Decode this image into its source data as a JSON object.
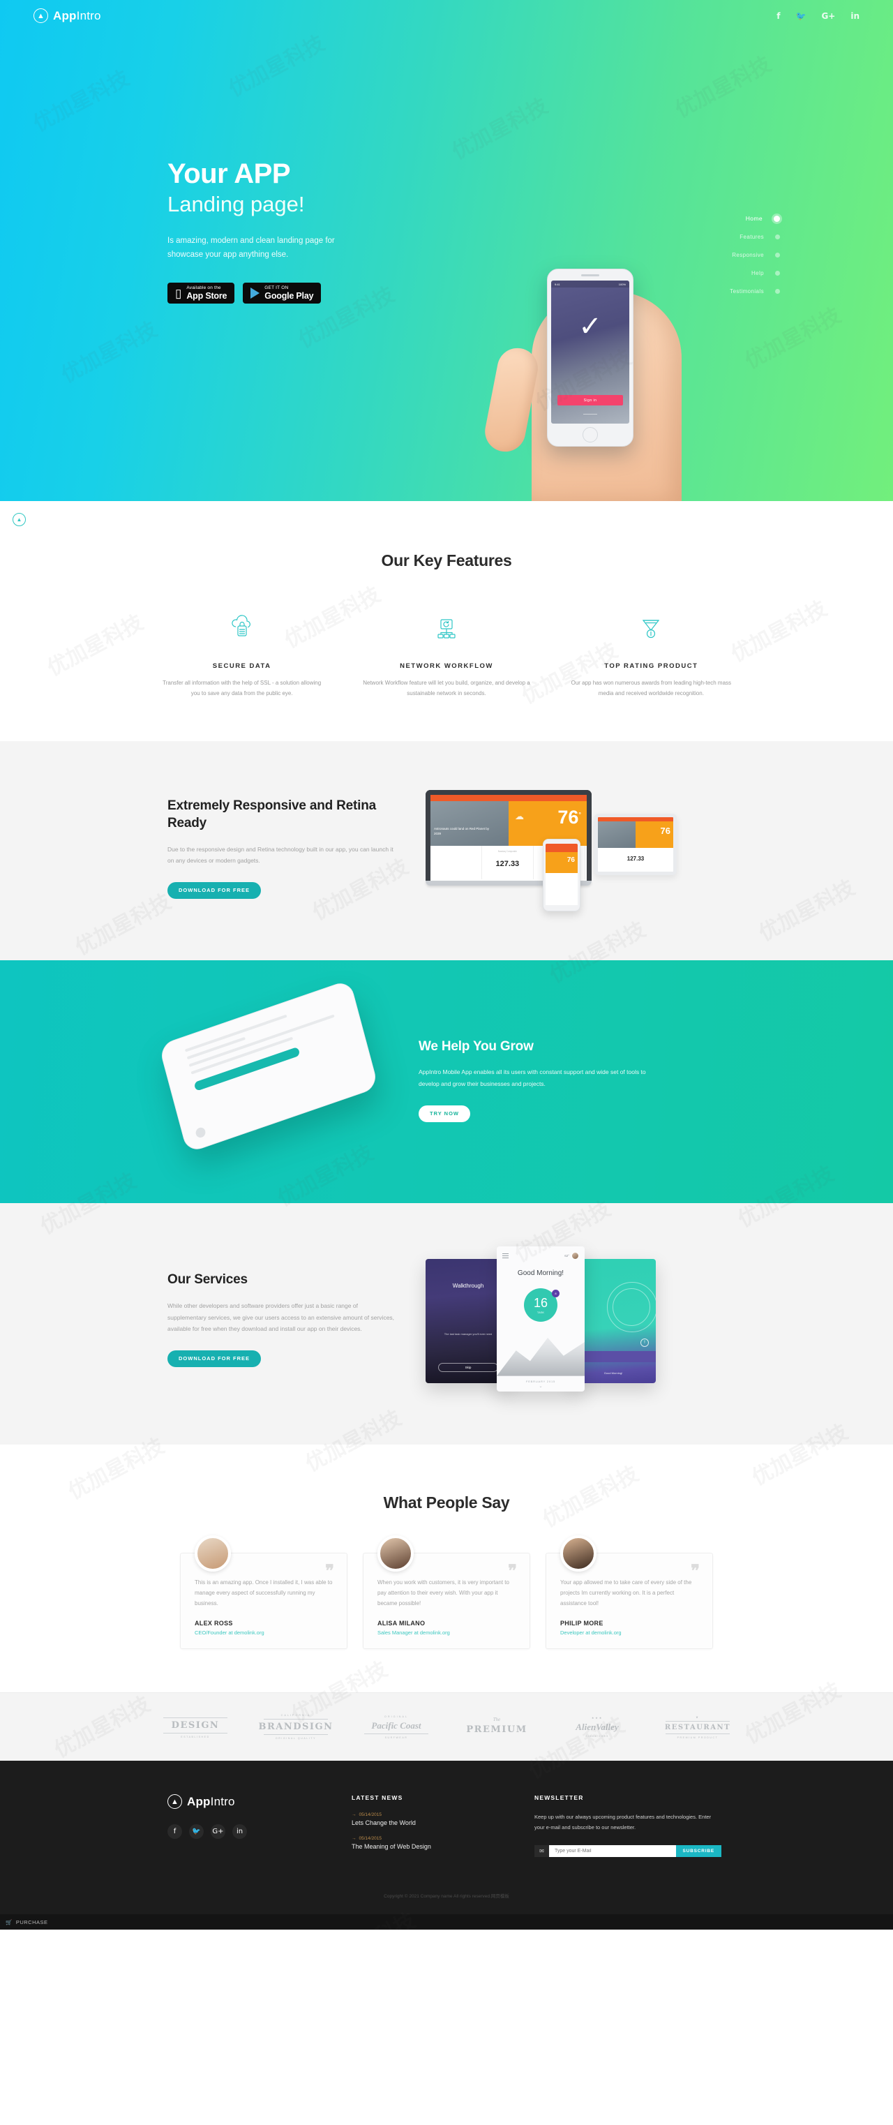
{
  "brand": {
    "mark": "A",
    "bold": "App",
    "light": "Intro"
  },
  "topbar": {
    "socials": [
      {
        "name": "facebook-icon",
        "glyph": "f"
      },
      {
        "name": "twitter-icon",
        "glyph": "🐦"
      },
      {
        "name": "google-plus-icon",
        "glyph": "G+"
      },
      {
        "name": "linkedin-icon",
        "glyph": "in"
      }
    ]
  },
  "hero": {
    "title": "Your APP",
    "subtitle": "Landing page!",
    "description": "Is amazing, modern and clean landing page for showcase your app anything else.",
    "buttons": [
      {
        "small": "Available on the",
        "big": "App Store",
        "icon": "apple-phone-icon"
      },
      {
        "small": "GET IT ON",
        "big": "Google Play",
        "icon": "google-play-icon"
      }
    ],
    "dotnav": [
      {
        "label": "Home",
        "active": true
      },
      {
        "label": "Features",
        "active": false
      },
      {
        "label": "Responsive",
        "active": false
      },
      {
        "label": "Help",
        "active": false
      },
      {
        "label": "Testimonials",
        "active": false
      }
    ],
    "phone": {
      "status_left": "9:41",
      "status_right": "100%",
      "check": "✓",
      "cta": "Sign in"
    },
    "scroll_top": "▲"
  },
  "features": {
    "title": "Our Key Features",
    "items": [
      {
        "icon": "cloud-lock-icon",
        "heading": "SECURE DATA",
        "text": "Transfer all information with the help of SSL - a solution allowing you to save any data from the public eye."
      },
      {
        "icon": "network-workflow-icon",
        "heading": "NETWORK WORKFLOW",
        "text": "Network Workflow feature will let you build, organize, and develop a sustainable network in seconds."
      },
      {
        "icon": "award-medal-icon",
        "heading": "TOP RATING PRODUCT",
        "text": "Our app has won numerous awards from leading high-tech mass media and received worldwide recognition."
      }
    ]
  },
  "responsive": {
    "title": "Extremely Responsive and Retina Ready",
    "text": "Due to the responsive design and Retina technology built in our app, you can launch it on any devices or modern gadgets.",
    "button": "DOWNLOAD FOR FREE",
    "mockup": {
      "temp": "76",
      "degree": "°",
      "stock": "127.33",
      "headline": "Astronauts could land on Red Planet by 2039",
      "weather_label": "Mostly Cloudy",
      "stock_label": "Nasdaq Composite"
    }
  },
  "grow": {
    "title": "We Help You Grow",
    "text": "AppIntro Mobile App enables all its users with constant support and wide set of tools to develop and grow their businesses and projects.",
    "button": "TRY NOW"
  },
  "services": {
    "title": "Our Services",
    "text": "While other developers and software providers offer just a basic range of supplementary services, we give our users access to an extensive amount of services, available for free when they download and install our app on their devices.",
    "button": "DOWNLOAD FOR FREE",
    "shots": {
      "left_title": "Walkthrough",
      "left_sub": "The last task manager you'll ever need",
      "left_btn": "Skip",
      "mid_greeting": "Good Morning!",
      "mid_temp": "62°",
      "mid_count": "16",
      "mid_count_label": "TASK",
      "mid_badge": "8",
      "mid_date": "FEBRUARY 2015",
      "right_text": "Good Morning!"
    }
  },
  "testimonials": {
    "title": "What People Say",
    "quote_mark": "❞",
    "items": [
      {
        "avatar": "avatar-alex-ross",
        "quote": "This is an amazing app. Once I installed it, I was able to manage every aspect of successfully running my business.",
        "name": "ALEX ROSS",
        "role": "CEO/Founder at demolink.org"
      },
      {
        "avatar": "avatar-alisa-milano",
        "quote": "When you work with customers, it is very important to pay attention to their every wish. With your app it became possible!",
        "name": "ALISA MILANO",
        "role": "Sales Manager at demolink.org"
      },
      {
        "avatar": "avatar-philip-more",
        "quote": "Your app allowed me to take care of every side of the projects Im currently working on. It is a perfect assistance tool!",
        "name": "PHILIP MORE",
        "role": "Developer at demolink.org"
      }
    ]
  },
  "brands": [
    {
      "up": "",
      "main": "DESIGN",
      "down": "ESTABLISHED"
    },
    {
      "up": "CALIFORNIA",
      "main": "BRANDSIGN",
      "down": "ORIGINAL QUALITY"
    },
    {
      "up": "ORIGINAL",
      "main": "Pacific Coast",
      "down": "SURFWEAR"
    },
    {
      "up": "The",
      "main": "PREMIUM",
      "down": ""
    },
    {
      "up": "",
      "main": "AlienValley",
      "down": "Since 2009"
    },
    {
      "up": "",
      "main": "RESTAURANT",
      "down": "PREMIUM PRODUCT"
    }
  ],
  "footer": {
    "socials": [
      {
        "name": "facebook-icon",
        "glyph": "f"
      },
      {
        "name": "twitter-icon",
        "glyph": "🐦"
      },
      {
        "name": "google-plus-icon",
        "glyph": "G+"
      },
      {
        "name": "linkedin-icon",
        "glyph": "in"
      }
    ],
    "news_heading": "LATEST NEWS",
    "news": [
      {
        "arrow": "→",
        "date": "05/14/2015",
        "title": "Lets Change the World"
      },
      {
        "arrow": "→",
        "date": "05/14/2015",
        "title": "The Meaning of Web Design"
      }
    ],
    "newsletter_heading": "NEWSLETTER",
    "newsletter_text": "Keep up with our always upcoming product features and technologies. Enter your e-mail and subscribe to our newsletter.",
    "mail_icon": "✉",
    "email_placeholder": "Type your E-Mail",
    "email_value": "",
    "subscribe": "SUBSCRIBE",
    "copyright": "Copyright © 2021 Company name All rights reserved.网页模板",
    "purchase": "PURCHASE",
    "cart_icon": "🛒"
  },
  "colors": {
    "accent": "#17b0b0",
    "teal": "#14c9a6",
    "cyan": "#0fc9f2",
    "green": "#72ef7c",
    "dark": "#1c1c1c"
  }
}
